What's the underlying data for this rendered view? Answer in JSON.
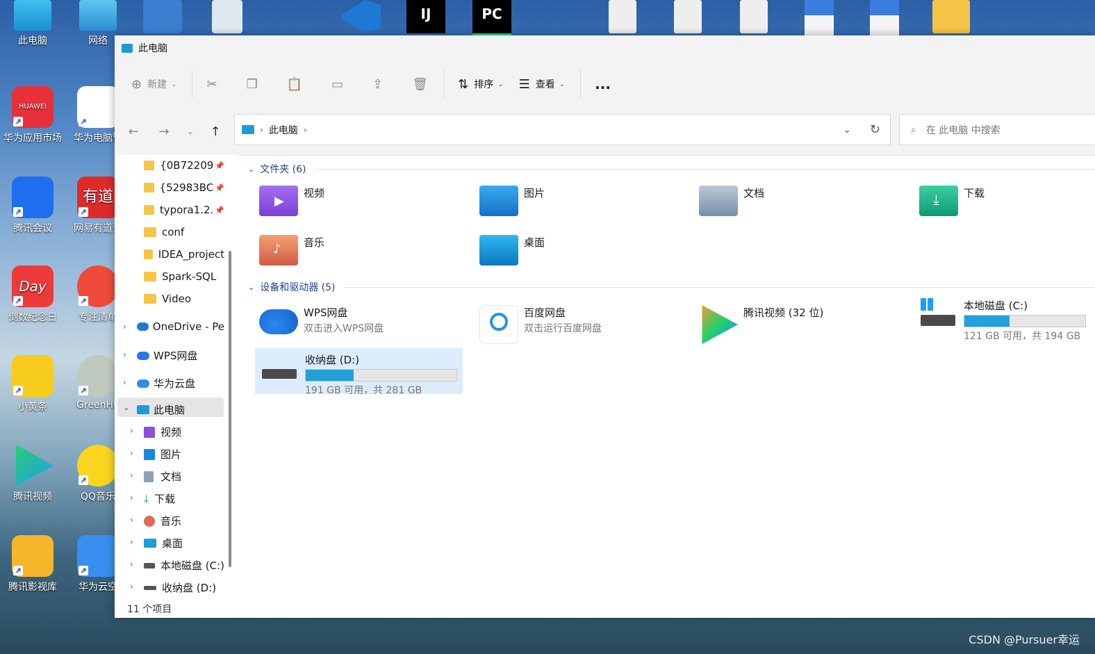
{
  "desktop": {
    "icons": [
      {
        "label": "此电脑"
      },
      {
        "label": "网络"
      },
      {
        "label": "华为应用市场",
        "badge": "HUAWEI"
      },
      {
        "label": "华为电脑管"
      },
      {
        "label": "腾讯会议"
      },
      {
        "label": "网易有道词",
        "badge": "有道"
      },
      {
        "label": "倒数纪念日",
        "badge": "Day"
      },
      {
        "label": "专注清单"
      },
      {
        "label": "小黄条"
      },
      {
        "label": "GreenHu"
      },
      {
        "label": "腾讯视频"
      },
      {
        "label": "QQ音乐"
      },
      {
        "label": "腾讯影视库"
      },
      {
        "label": "华为云空"
      }
    ],
    "top_icons": [
      "IJ",
      "PC"
    ],
    "watermark": "CSDN @Pursuer幸运"
  },
  "window": {
    "title": "此电脑",
    "ribbon": {
      "new_label": "新建",
      "sort_label": "排序",
      "view_label": "查看",
      "more_label": "..."
    },
    "address": {
      "crumb": "此电脑",
      "search_placeholder": "在 此电脑 中搜索"
    },
    "sidebar": {
      "quick": [
        "{0B72209",
        "{52983BC",
        "typora1.2.",
        "conf",
        "IDEA_project",
        "Spark-SQL",
        "Video"
      ],
      "onedrive": "OneDrive - Pe",
      "wps": "WPS网盘",
      "huawei": "华为云盘",
      "thispc": "此电脑",
      "children": [
        "视频",
        "图片",
        "文档",
        "下载",
        "音乐",
        "桌面",
        "本地磁盘 (C:)",
        "收纳盘 (D:)"
      ]
    },
    "status": "11 个项目",
    "folders_header": "文件夹 (6)",
    "folders": [
      {
        "name": "视频"
      },
      {
        "name": "图片"
      },
      {
        "name": "文档"
      },
      {
        "name": "下载"
      },
      {
        "name": "音乐"
      },
      {
        "name": "桌面"
      }
    ],
    "devices_header": "设备和驱动器 (5)",
    "devices": [
      {
        "name": "WPS网盘",
        "sub": "双击进入WPS网盘"
      },
      {
        "name": "百度网盘",
        "sub": "双击运行百度网盘"
      },
      {
        "name": "腾讯视频 (32 位)",
        "sub": ""
      },
      {
        "name": "本地磁盘 (C:)",
        "sub": "121 GB 可用，共 194 GB",
        "used_fraction": 0.376
      },
      {
        "name": "收纳盘 (D:)",
        "sub": "191 GB 可用，共 281 GB",
        "used_fraction": 0.32
      }
    ]
  }
}
